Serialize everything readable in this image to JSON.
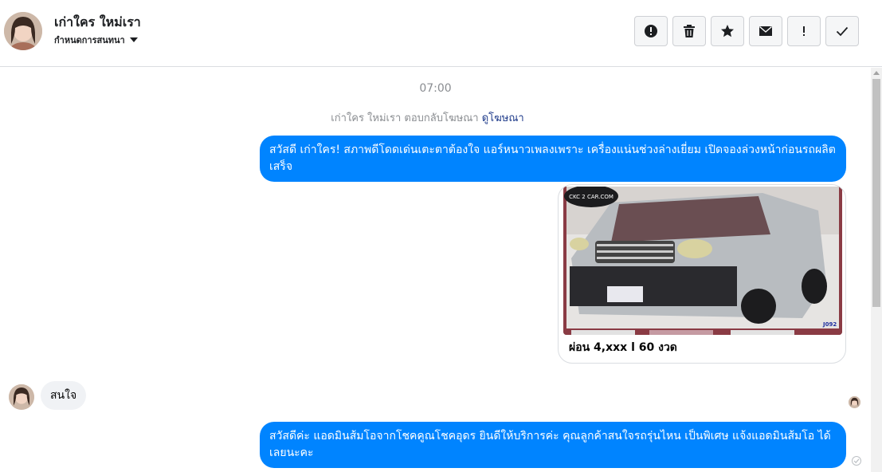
{
  "contact": {
    "name": "เก่าใคร ใหม่เรา",
    "settings_label": "กำหนดการสนทนา"
  },
  "toolbar": {
    "buttons": [
      {
        "icon": "exclamation-circle-icon"
      },
      {
        "icon": "trash-icon"
      },
      {
        "icon": "star-icon"
      },
      {
        "icon": "envelope-icon"
      },
      {
        "icon": "exclamation-icon"
      },
      {
        "icon": "check-icon"
      }
    ]
  },
  "thread": {
    "timestamp": "07:00",
    "ad_reply": {
      "text": "เก่าใคร ใหม่เรา ตอบกลับโฆษณา",
      "link": "ดูโฆษณา"
    },
    "messages": [
      {
        "direction": "outgoing",
        "text": "สวัสดี เก่าใคร! สภาพดีโดดเด่นเตะตาต้องใจ แอร์หนาวเพลงเพราะ เครื่องแน่นช่วงล่างเยี่ยม เปิดจองล่วงหน้าก่อนรถผลิตเสร็จ"
      },
      {
        "direction": "outgoing",
        "type": "ad-card",
        "image_watermark": "CKC 2 CAR.COM",
        "image_stock_tag": "J092",
        "caption": "ผ่อน 4,xxx l 60 งวด"
      },
      {
        "direction": "incoming",
        "text": "สนใจ"
      },
      {
        "direction": "outgoing",
        "text": "สวัสดีค่ะ แอดมินส้มโอจากโชคคูณโชคอุดร ยินดีให้บริการค่ะ   คุณลูกค้าสนใจรถรุ่นไหน เป็นพิเศษ แจ้งแอดมินส้มโอ ได้เลยนะคะ"
      }
    ]
  },
  "colors": {
    "outgoing_bubble": "#0084ff",
    "incoming_bubble": "#f0f2f5",
    "link": "#1e3a8a",
    "meta_text": "#8a8d91"
  }
}
